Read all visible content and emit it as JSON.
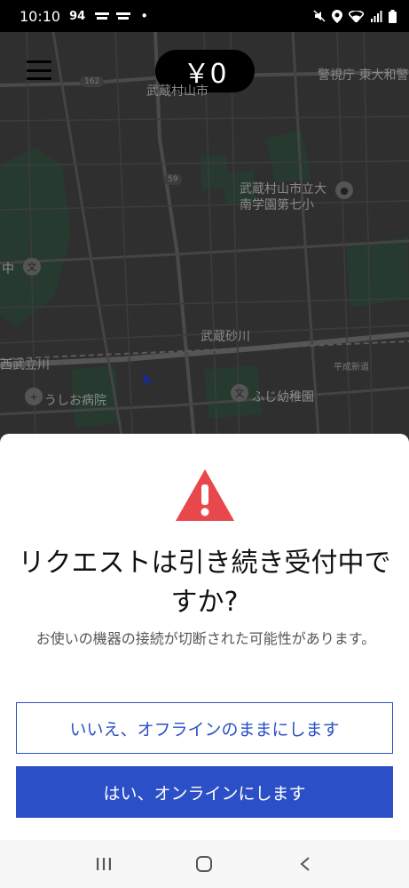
{
  "status_bar": {
    "time": "10:10",
    "indicator": "94",
    "dot": "•",
    "icons": [
      "notification-icon",
      "notification-icon",
      "mute-icon",
      "location-icon",
      "wifi-icon",
      "signal-icon",
      "battery-icon"
    ]
  },
  "map": {
    "earnings": "￥0",
    "labels": {
      "top_right": "警視庁 東大和警",
      "top_center": "武蔵村山市",
      "school_line1": "武蔵村山市立大",
      "school_line2": "南学園第七小",
      "station_center": "武蔵砂川",
      "station_left": "西武立川",
      "hospital": "うしお病院",
      "kindergarten": "ふじ幼稚園",
      "left_edge": "中",
      "road_small": "平成新道",
      "route_162": "162",
      "route_59": "59"
    }
  },
  "dialog": {
    "title": "リクエストは引き続き受付中ですか?",
    "body": "お使いの機器の接続が切断された可能性があります。",
    "secondary_button": "いいえ、オフラインのままにします",
    "primary_button": "はい、オンラインにします"
  },
  "colors": {
    "accent": "#2b4fc7",
    "warning": "#e8484b"
  }
}
